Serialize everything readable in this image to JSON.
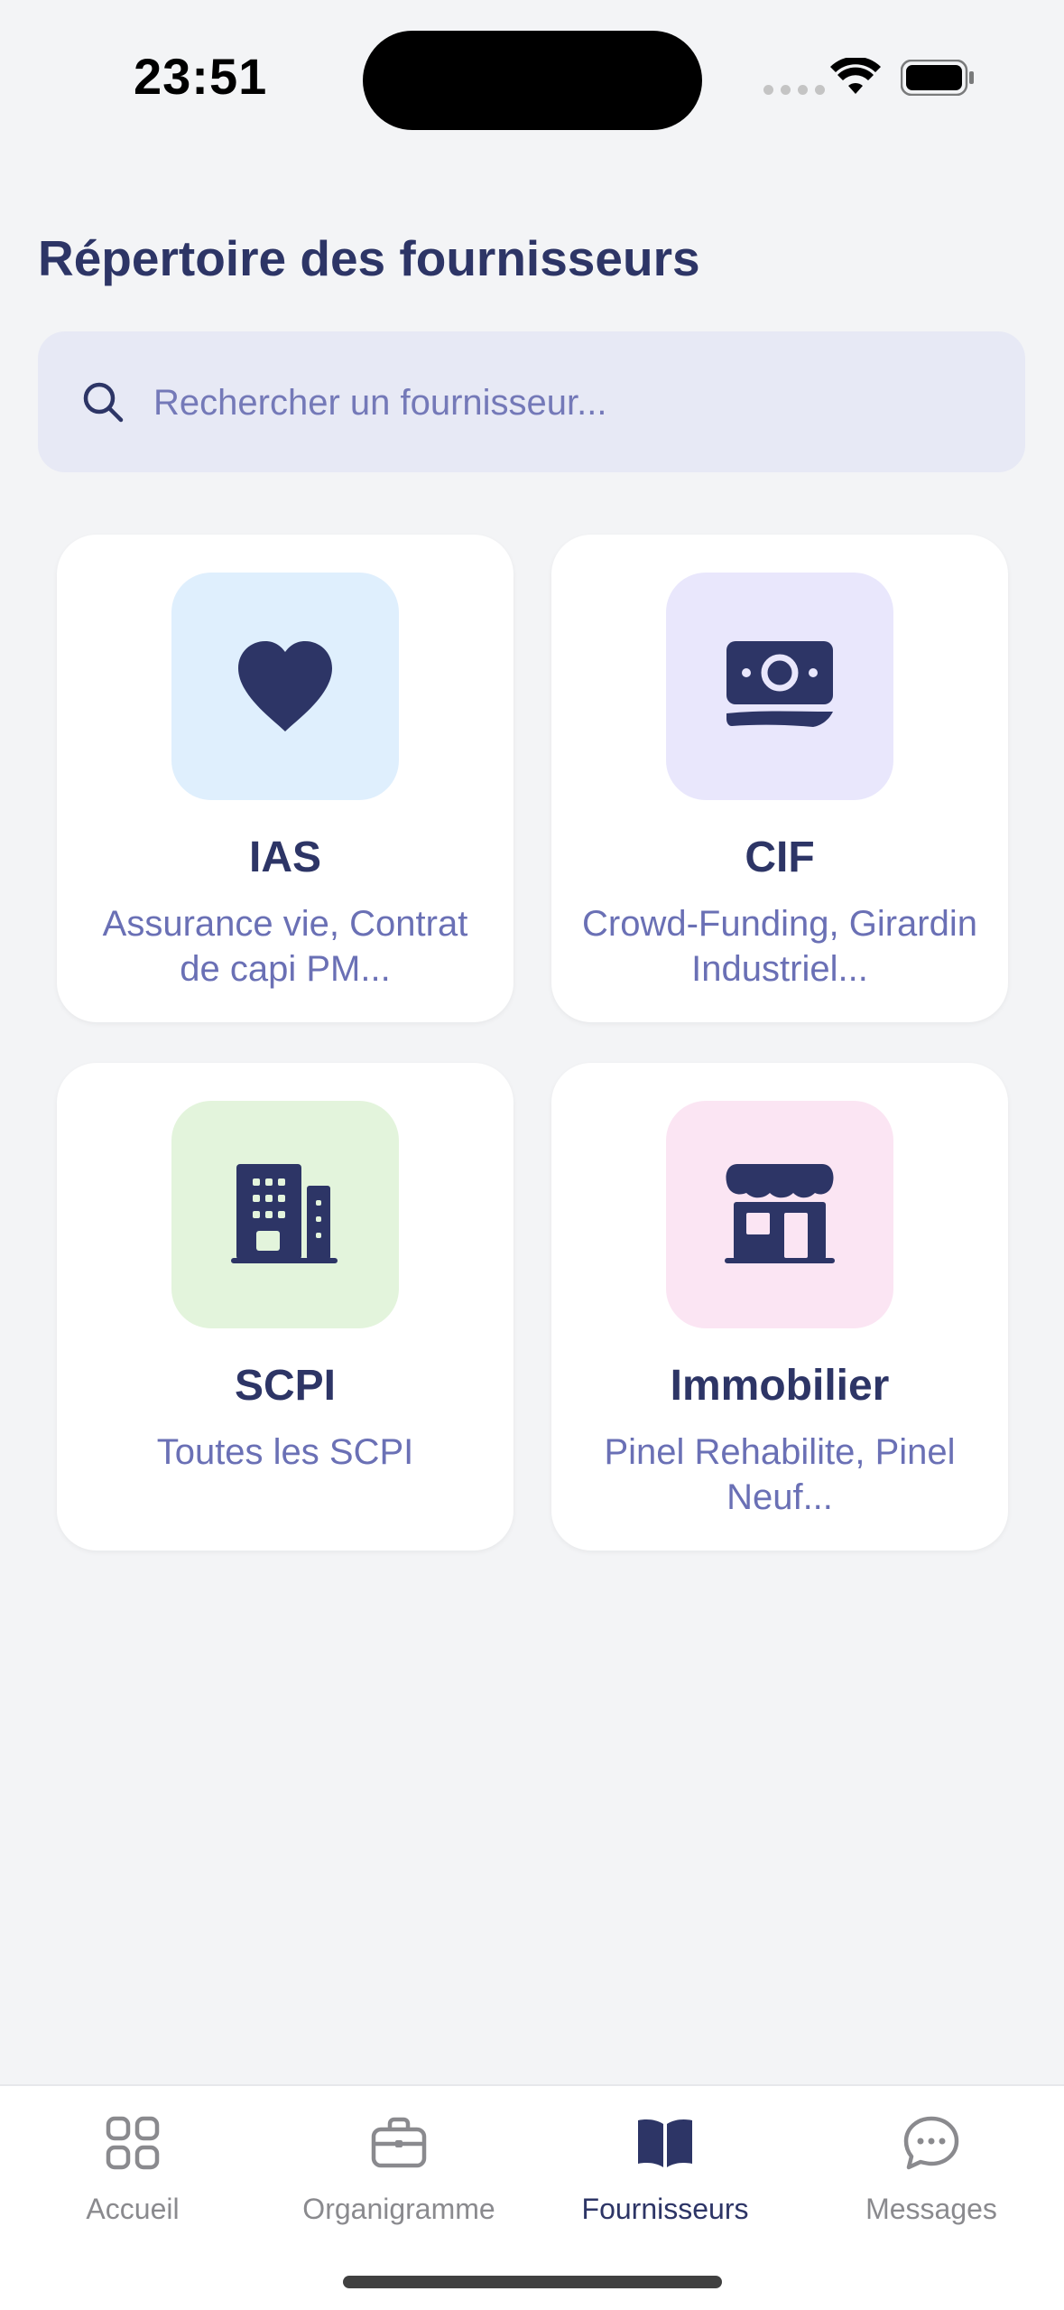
{
  "status_bar": {
    "time": "23:51"
  },
  "page": {
    "title": "Répertoire des fournisseurs"
  },
  "search": {
    "placeholder": "Rechercher un fournisseur..."
  },
  "categories": [
    {
      "title": "IAS",
      "subtitle": "Assurance vie, Contrat de capi PM...",
      "icon": "heart-icon",
      "bg": "#dfeffd"
    },
    {
      "title": "CIF",
      "subtitle": "Crowd-Funding, Girardin Industriel...",
      "icon": "money-bill-icon",
      "bg": "#e9e7fc"
    },
    {
      "title": "SCPI",
      "subtitle": "Toutes les SCPI",
      "icon": "building-icon",
      "bg": "#e3f4dc"
    },
    {
      "title": "Immobilier",
      "subtitle": "Pinel Rehabilite, Pinel Neuf...",
      "icon": "shop-icon",
      "bg": "#fbe5f3"
    }
  ],
  "tabs": [
    {
      "label": "Accueil",
      "icon": "grid-icon",
      "active": false
    },
    {
      "label": "Organigramme",
      "icon": "briefcase-icon",
      "active": false
    },
    {
      "label": "Fournisseurs",
      "icon": "book-icon",
      "active": true
    },
    {
      "label": "Messages",
      "icon": "chat-icon",
      "active": false
    }
  ],
  "colors": {
    "primary": "#2d3566",
    "accent": "#6a70b5",
    "background": "#f3f4f6",
    "inactive": "#8a8a8e"
  }
}
